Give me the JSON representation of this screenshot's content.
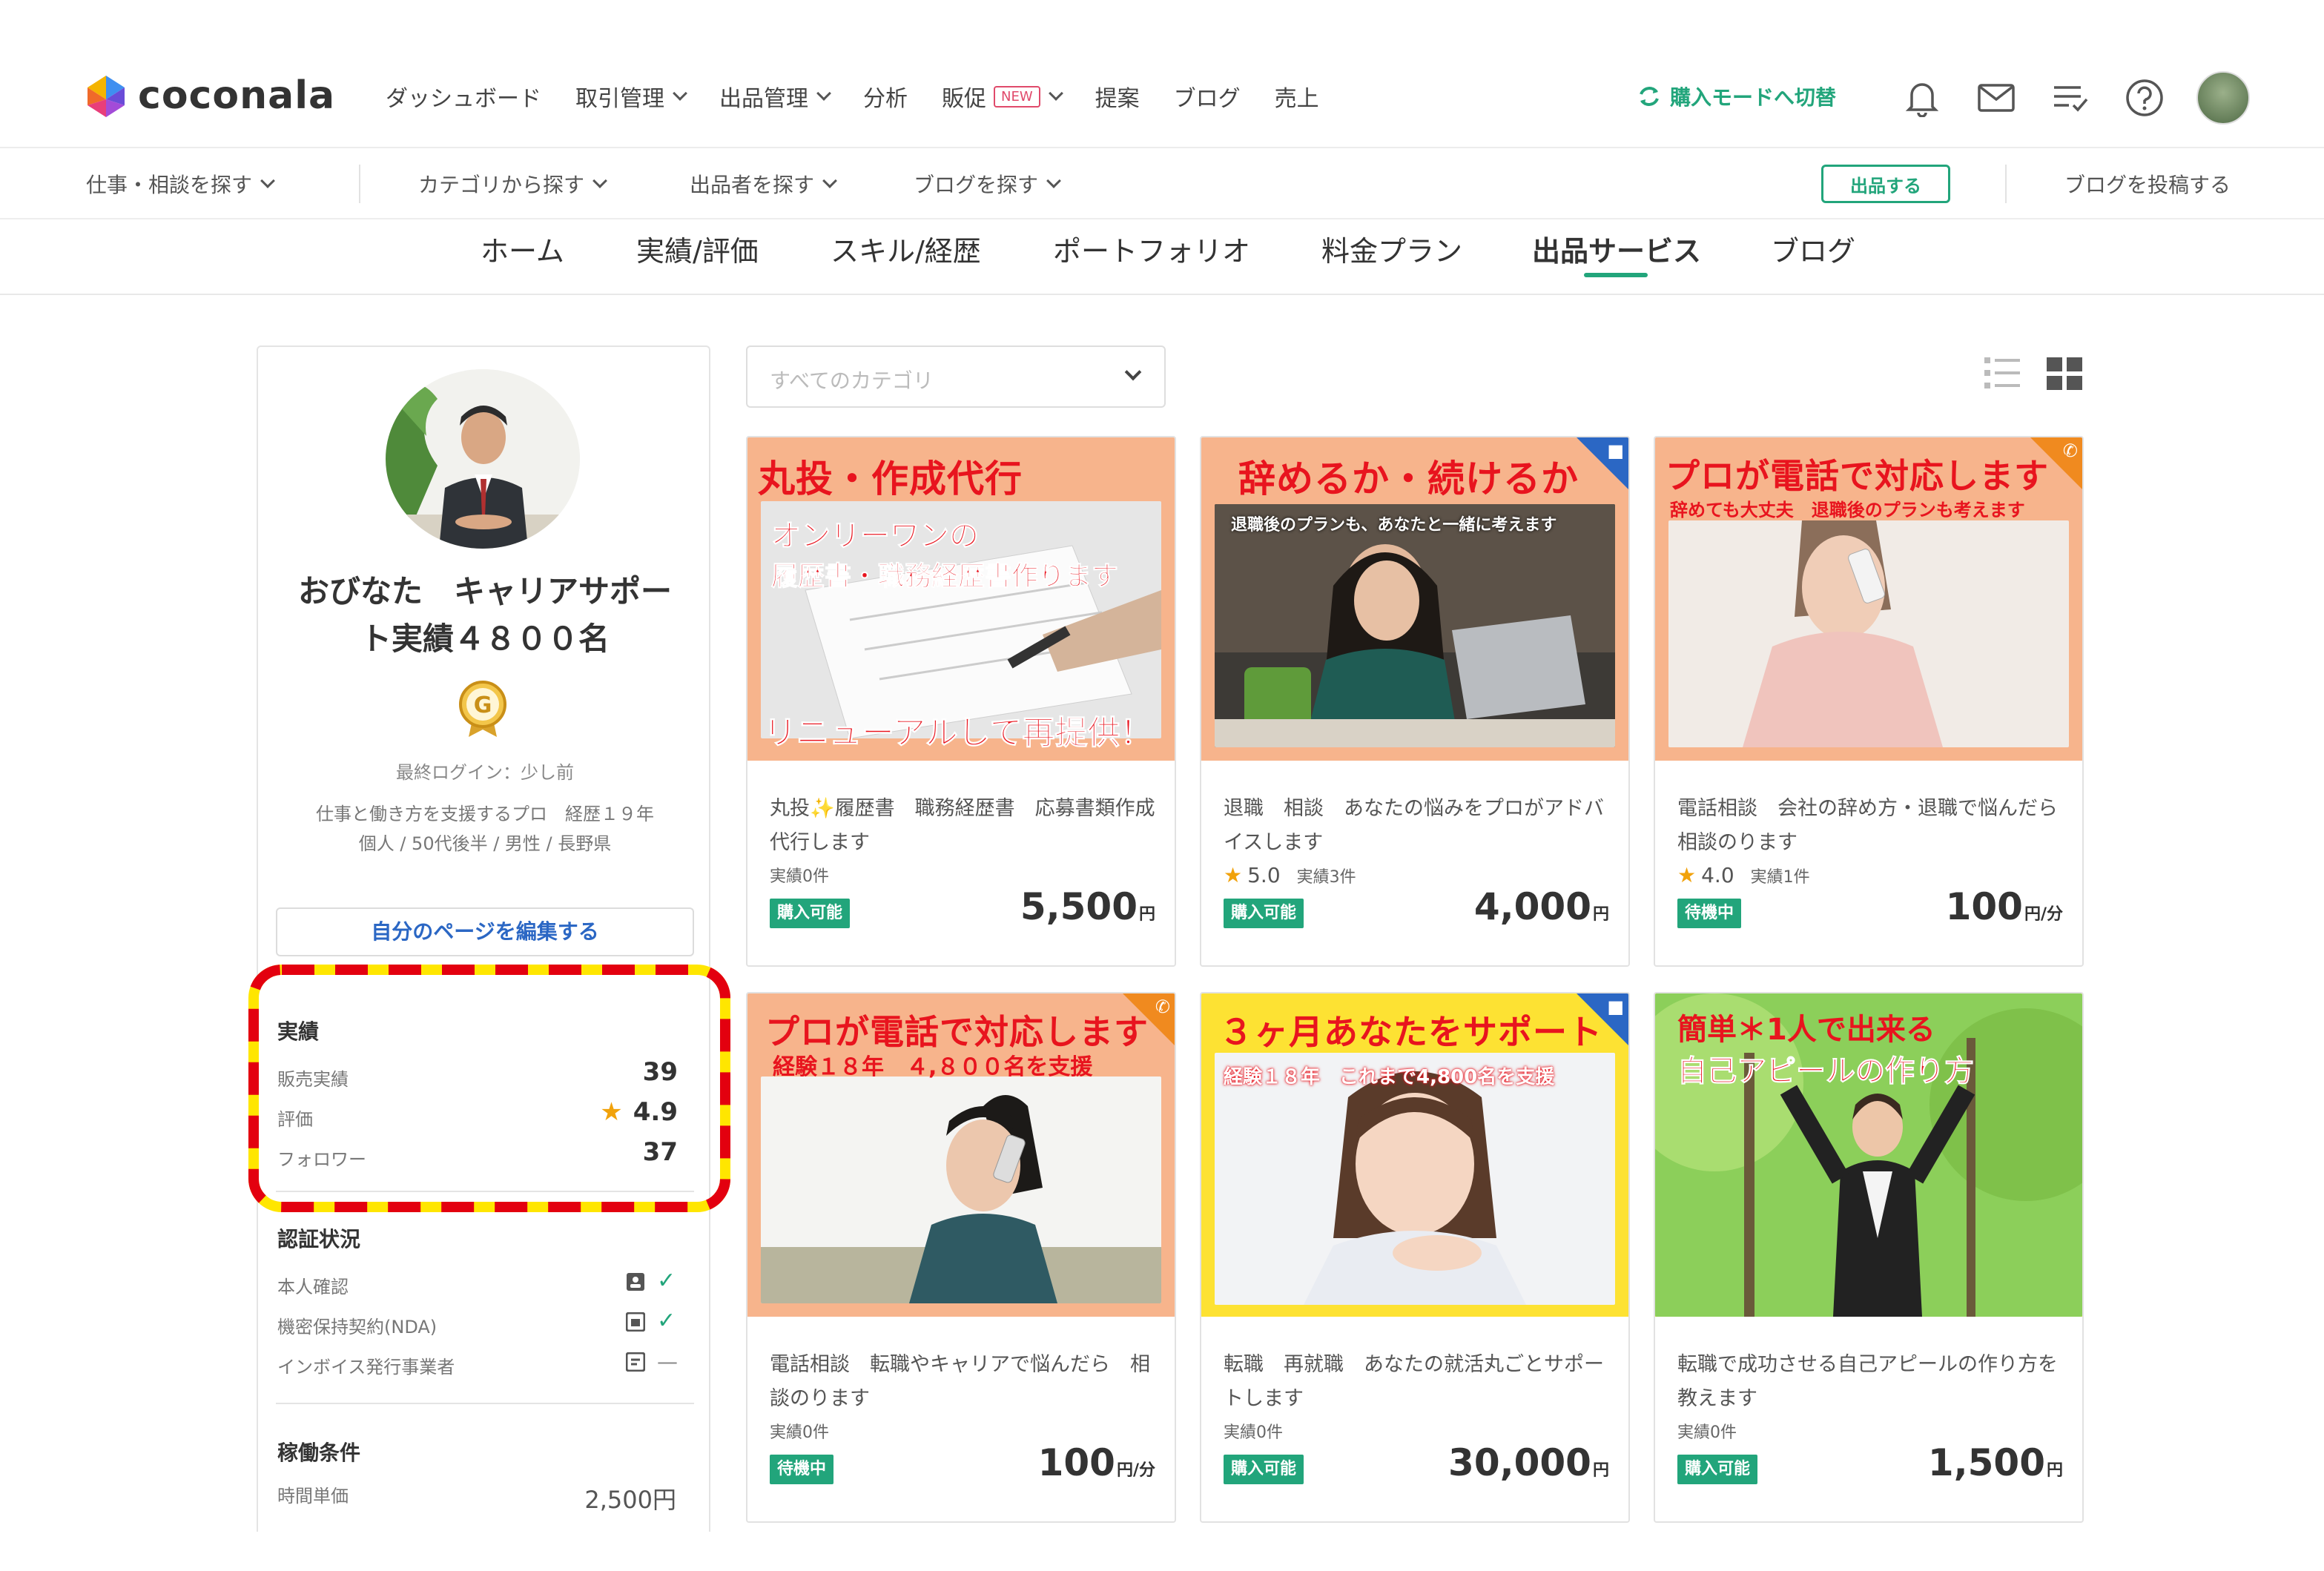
{
  "header": {
    "logo_text": "coconala",
    "nav": [
      {
        "label": "ダッシュボード"
      },
      {
        "label": "取引管理"
      },
      {
        "label": "出品管理"
      },
      {
        "label": "分析"
      },
      {
        "label": "販促"
      },
      {
        "label": "提案"
      },
      {
        "label": "ブログ"
      },
      {
        "label": "売上"
      }
    ],
    "new_badge": "NEW",
    "mode_switch": "購入モードへ切替"
  },
  "subnav": {
    "items": [
      {
        "label": "仕事・相談を探す"
      },
      {
        "label": "カテゴリから探す"
      },
      {
        "label": "出品者を探す"
      },
      {
        "label": "ブログを探す"
      }
    ],
    "post_button": "出品する",
    "blog_post": "ブログを投稿する"
  },
  "tabs": [
    {
      "label": "ホーム"
    },
    {
      "label": "実績/評価"
    },
    {
      "label": "スキル/経歴"
    },
    {
      "label": "ポートフォリオ"
    },
    {
      "label": "料金プラン"
    },
    {
      "label": "出品サービス"
    },
    {
      "label": "ブログ"
    }
  ],
  "profile": {
    "name": "おびなた　キャリアサポート実績４８００名",
    "badge_letter": "G",
    "last_login": "最終ログイン：少し前",
    "tagline_1": "仕事と働き方を支援するプロ　経歴１９年",
    "tagline_2": "個人 / 50代後半 / 男性 / 長野県",
    "edit_button": "自分のページを編集する"
  },
  "stats": {
    "title": "実績",
    "sales_label": "販売実績",
    "sales_value": "39",
    "rating_label": "評価",
    "rating_value": "4.9",
    "followers_label": "フォロワー",
    "followers_value": "37"
  },
  "certification": {
    "title": "認証状況",
    "identity": "本人確認",
    "nda": "機密保持契約(NDA)",
    "invoice": "インボイス発行事業者"
  },
  "work_conditions": {
    "title": "稼働条件",
    "hourly_label": "時間単価",
    "hourly_value": "2,500円"
  },
  "category_select": {
    "placeholder": "すべてのカテゴリ"
  },
  "cards": [
    {
      "thumb_title": "丸投・作成代行",
      "thumb_sub1": "オンリーワンの",
      "thumb_sub2": "履歴書・職務経歴書作ります",
      "thumb_bottom": "リニューアルして再提供！",
      "desc": "丸投✨履歴書　職務経歴書　応募書類作成代行します",
      "meta": "実績0件",
      "status": "購入可能",
      "price": "5,500",
      "unit": "円"
    },
    {
      "thumb_title": "辞めるか・続けるか",
      "thumb_sub1": "退職後のプランも、あなたと一緒に考えます",
      "desc": "退職　相談　あなたの悩みをプロがアドバイスします",
      "rating": "5.0",
      "meta": "実績3件",
      "status": "購入可能",
      "price": "4,000",
      "unit": "円"
    },
    {
      "thumb_title": "プロが電話で対応します",
      "thumb_sub1": "辞めても大丈夫　退職後のプランも考えます",
      "desc": "電話相談　会社の辞め方・退職で悩んだら相談のります",
      "rating": "4.0",
      "meta": "実績1件",
      "status": "待機中",
      "price": "100",
      "unit": "円/分"
    },
    {
      "thumb_title": "プロが電話で対応します",
      "thumb_sub1": "経験１８年　４,８００名を支援",
      "desc": "電話相談　転職やキャリアで悩んだら　相談のります",
      "meta": "実績0件",
      "status": "待機中",
      "price": "100",
      "unit": "円/分"
    },
    {
      "thumb_title": "３ヶ月あなたをサポート",
      "thumb_sub1": "経験１８年　これまで4,800名を支援",
      "desc": "転職　再就職　あなたの就活丸ごとサポートします",
      "meta": "実績0件",
      "status": "購入可能",
      "price": "30,000",
      "unit": "円"
    },
    {
      "thumb_title": "簡単＊1人で出来る",
      "thumb_sub1": "自己アピールの作り方",
      "desc": "転職で成功させる自己アピールの作り方を教えます",
      "meta": "実績0件",
      "status": "購入可能",
      "price": "1,500",
      "unit": "円"
    }
  ],
  "colors": {
    "accent_green": "#22a57b",
    "link_blue": "#2b67c4",
    "highlight_red": "#e3000f",
    "highlight_yellow": "#ffe600",
    "card_red": "#e8141e",
    "card_orange_bg": "#f7b48c",
    "card_yellow_bg": "#fde233"
  }
}
